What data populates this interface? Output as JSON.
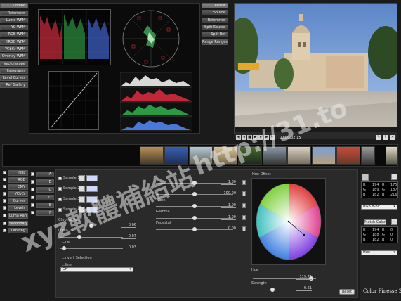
{
  "scope_nav": [
    "Combo",
    "Reference",
    "Luma WFM",
    "YC WFM",
    "RGB WFM",
    "YRGB WFM",
    "YCbCr WFM",
    "Overlay WFM",
    "Vectorscope",
    "Histograms",
    "Level Curves",
    "Ref Gallery"
  ],
  "view_nav": [
    "Result",
    "Source",
    "Reference",
    "Split Source",
    "Split Ref",
    "Range Ranges"
  ],
  "timecode": "00:00:02:15",
  "transport_icons": [
    "play-back-icon",
    "step-back-icon",
    "stop-icon",
    "play-icon",
    "step-forward-icon",
    "play-forward-icon",
    "loop-icon"
  ],
  "transport_right_icons": [
    "eyedropper-icon",
    "help-icon",
    "close-icon"
  ],
  "range_nav": [
    "HSL",
    "RGB",
    "CMY",
    "YCbCr",
    "Curves",
    "Levels",
    "Luma Range",
    "Secondary",
    "Limiting"
  ],
  "range_letters": [
    "A",
    "B",
    "C",
    "D",
    "E",
    "F"
  ],
  "samples": [
    "Sample 1",
    "Sample 2",
    "Sample 3",
    "Sample 4"
  ],
  "sliders": {
    "chroma_tolerance": {
      "label": "Chroma To...",
      "value": "0.06",
      "pos": 0.5
    },
    "luma_tolerance": {
      "label": "Luma To...",
      "value": "0.07",
      "pos": 0.3
    },
    "softness": {
      "label": "...ne",
      "value": "0.03",
      "pos": 0.05
    },
    "hue": {
      "label": "",
      "value": "1.00",
      "pos": 0.5
    },
    "saturation": {
      "label": "",
      "value": "100.00",
      "pos": 0.5
    },
    "gain": {
      "label": "Gain",
      "value": "1.00",
      "pos": 0.5
    },
    "gamma": {
      "label": "Gamma",
      "value": "1.00",
      "pos": 0.5
    },
    "pedestal": {
      "label": "Pedestal",
      "value": "0.00",
      "pos": 0.5
    }
  },
  "invert_label": "...nvert Selection",
  "view_label": "...line",
  "view_select": "Off",
  "hue_offset_label": "Hue Offset",
  "hue_slider": {
    "label": "Hue",
    "value": "119.71",
    "pos": 0.9
  },
  "strength_slider": {
    "label": "Strength",
    "value": "0.61",
    "pos": 0.3
  },
  "reset_label": "Reset",
  "rgb_top": {
    "R": "194",
    "G": "189",
    "B": "182",
    "R2": "175",
    "G2": "187",
    "B2": "216"
  },
  "rgb_mode": "RGB 8-bit",
  "match_color_label": "Match Color",
  "rgb_bottom": {
    "R": "194",
    "G": "188",
    "B": "182",
    "R2": "0",
    "G2": "0",
    "B2": "0"
  },
  "hue_select": "Hue",
  "brand": "Color Finesse 2",
  "watermark_cjk": "xyz軟體補給站",
  "watermark_url": "http://31.to"
}
